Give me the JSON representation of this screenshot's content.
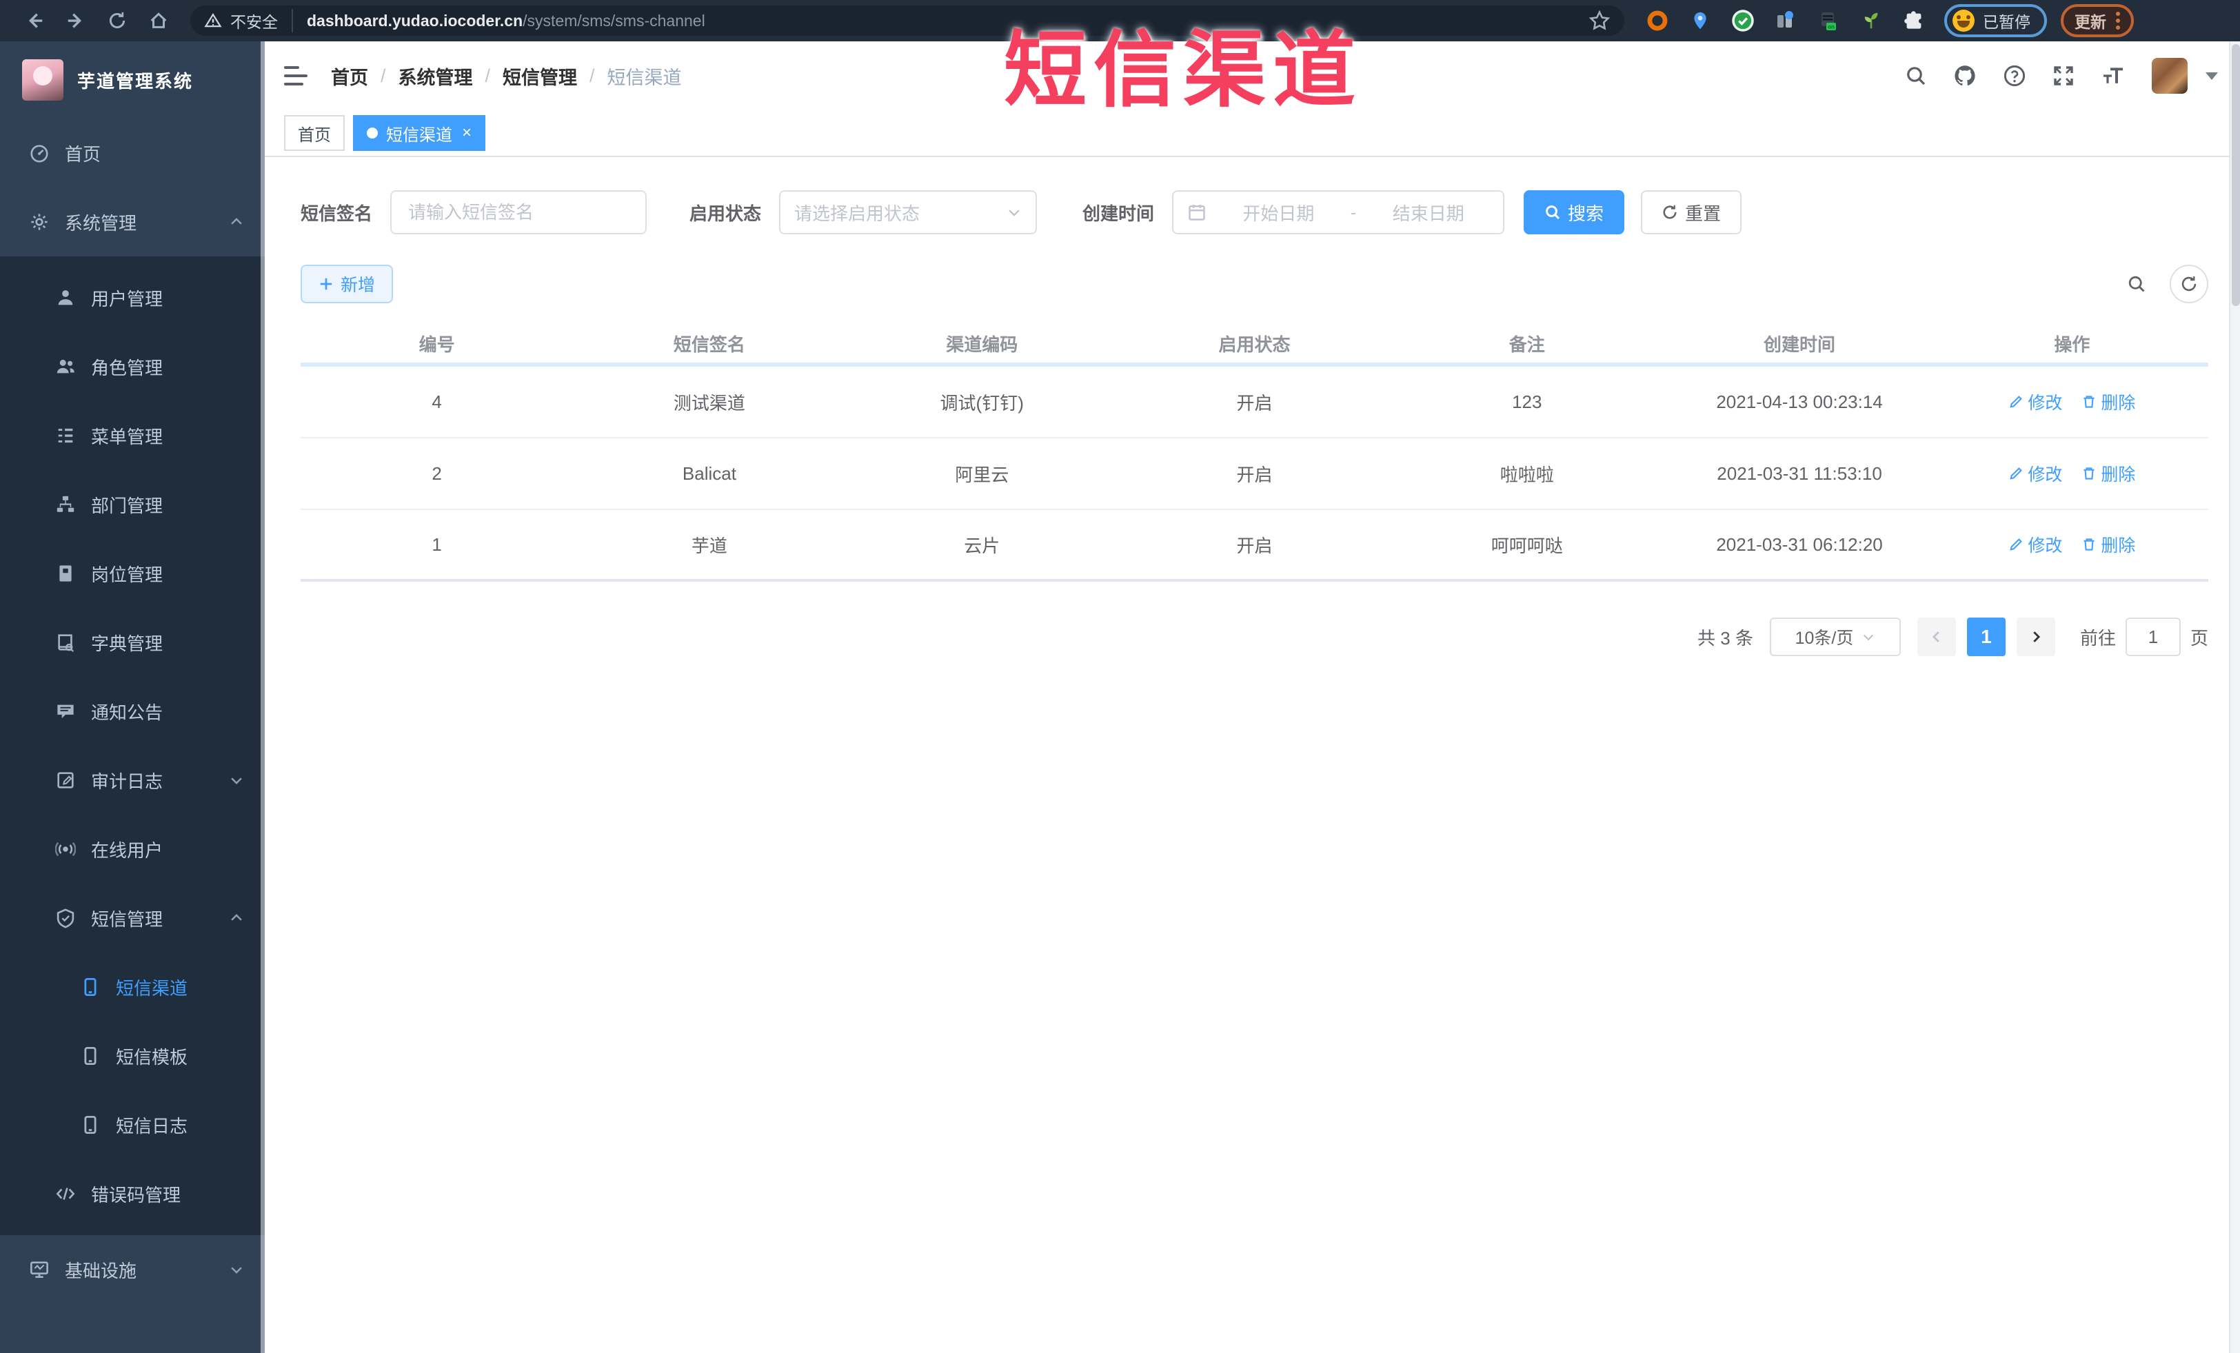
{
  "browser": {
    "security_label": "不安全",
    "url_host": "dashboard.yudao.iocoder.cn",
    "url_path": "/system/sms/sms-channel",
    "paused_label": "已暂停",
    "update_label": "更新"
  },
  "sidebar": {
    "app_title": "芋道管理系统",
    "menu": [
      {
        "label": "首页"
      },
      {
        "label": "系统管理"
      },
      {
        "label": "用户管理"
      },
      {
        "label": "角色管理"
      },
      {
        "label": "菜单管理"
      },
      {
        "label": "部门管理"
      },
      {
        "label": "岗位管理"
      },
      {
        "label": "字典管理"
      },
      {
        "label": "通知公告"
      },
      {
        "label": "审计日志"
      },
      {
        "label": "在线用户"
      },
      {
        "label": "短信管理"
      },
      {
        "label": "短信渠道"
      },
      {
        "label": "短信模板"
      },
      {
        "label": "短信日志"
      },
      {
        "label": "错误码管理"
      },
      {
        "label": "基础设施"
      }
    ]
  },
  "navbar": {
    "breadcrumb": [
      "首页",
      "系统管理",
      "短信管理",
      "短信渠道"
    ],
    "separator": "/"
  },
  "tabs": {
    "home": "首页",
    "active": "短信渠道",
    "close": "×"
  },
  "filter": {
    "sign_label": "短信签名",
    "sign_placeholder": "请输入短信签名",
    "status_label": "启用状态",
    "status_placeholder": "请选择启用状态",
    "time_label": "创建时间",
    "start_placeholder": "开始日期",
    "range_separator": "-",
    "end_placeholder": "结束日期",
    "search_label": "搜索",
    "reset_label": "重置"
  },
  "toolbar": {
    "add_label": "新增"
  },
  "table": {
    "headers": [
      "编号",
      "短信签名",
      "渠道编码",
      "启用状态",
      "备注",
      "创建时间",
      "操作"
    ],
    "rows": [
      {
        "id": "4",
        "sign": "测试渠道",
        "code": "调试(钉钉)",
        "status": "开启",
        "remark": "123",
        "created": "2021-04-13 00:23:14"
      },
      {
        "id": "2",
        "sign": "Balicat",
        "code": "阿里云",
        "status": "开启",
        "remark": "啦啦啦",
        "created": "2021-03-31 11:53:10"
      },
      {
        "id": "1",
        "sign": "芋道",
        "code": "云片",
        "status": "开启",
        "remark": "呵呵呵哒",
        "created": "2021-03-31 06:12:20"
      }
    ],
    "edit_label": "修改",
    "delete_label": "删除"
  },
  "pagination": {
    "total": "共 3 条",
    "page_size": "10条/页",
    "page": "1",
    "goto_label": "前往",
    "goto_value": "1",
    "page_unit": "页"
  },
  "annotation": {
    "text": "短信渠道",
    "color": "#f43f5e"
  },
  "colors": {
    "accent": "#409EFF",
    "sidebar_bg": "#304156",
    "submenu_bg": "#1f2d3d",
    "browser_bar_bg": "#222e3c"
  }
}
